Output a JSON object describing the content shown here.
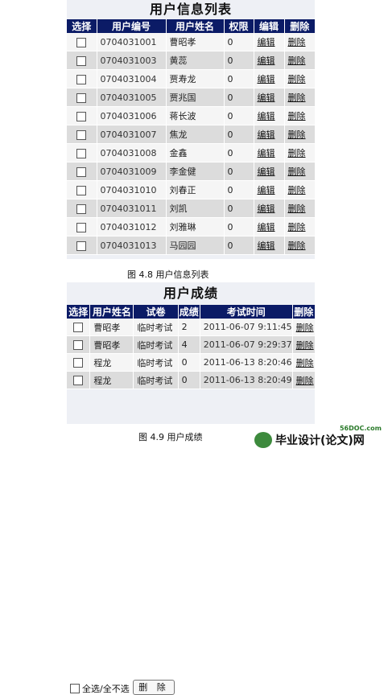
{
  "users_panel": {
    "title": "用户信息列表",
    "headers": [
      "选择",
      "用户编号",
      "用户姓名",
      "权限",
      "编辑",
      "删除"
    ],
    "rows": [
      {
        "id": "0704031001",
        "name": "曹昭孝",
        "perm": "0",
        "edit": "编辑",
        "del": "删除"
      },
      {
        "id": "0704031003",
        "name": "黄蕊",
        "perm": "0",
        "edit": "编辑",
        "del": "删除"
      },
      {
        "id": "0704031004",
        "name": "贾寿龙",
        "perm": "0",
        "edit": "编辑",
        "del": "删除"
      },
      {
        "id": "0704031005",
        "name": "贾兆国",
        "perm": "0",
        "edit": "编辑",
        "del": "删除"
      },
      {
        "id": "0704031006",
        "name": "蒋长波",
        "perm": "0",
        "edit": "编辑",
        "del": "删除"
      },
      {
        "id": "0704031007",
        "name": "焦龙",
        "perm": "0",
        "edit": "编辑",
        "del": "删除"
      },
      {
        "id": "0704031008",
        "name": "金鑫",
        "perm": "0",
        "edit": "编辑",
        "del": "删除"
      },
      {
        "id": "0704031009",
        "name": "李金健",
        "perm": "0",
        "edit": "编辑",
        "del": "删除"
      },
      {
        "id": "0704031010",
        "name": "刘春正",
        "perm": "0",
        "edit": "编辑",
        "del": "删除"
      },
      {
        "id": "0704031011",
        "name": "刘凯",
        "perm": "0",
        "edit": "编辑",
        "del": "删除"
      },
      {
        "id": "0704031012",
        "name": "刘雅琳",
        "perm": "0",
        "edit": "编辑",
        "del": "删除"
      },
      {
        "id": "0704031013",
        "name": "马园园",
        "perm": "0",
        "edit": "编辑",
        "del": "删除"
      }
    ]
  },
  "caption1": "图 4.8  用户信息列表",
  "scores_panel": {
    "title": "用户成绩",
    "headers": [
      "选择",
      "用户姓名",
      "试卷",
      "成绩",
      "考试时间",
      "删除"
    ],
    "rows": [
      {
        "name": "曹昭孝",
        "paper": "临时考试",
        "score": "2",
        "time": "2011-06-07 9:11:45",
        "del": "删除"
      },
      {
        "name": "曹昭孝",
        "paper": "临时考试",
        "score": "4",
        "time": "2011-06-07 9:29:37",
        "del": "删除"
      },
      {
        "name": "程龙",
        "paper": "临时考试",
        "score": "0",
        "time": "2011-06-13 8:20:46",
        "del": "删除"
      },
      {
        "name": "程龙",
        "paper": "临时考试",
        "score": "0",
        "time": "2011-06-13 8:20:49",
        "del": "删除"
      }
    ],
    "select_all_label": "全选/全不选",
    "delete_button_label": "删 除"
  },
  "caption2": "图 4.9  用户成绩",
  "brand": {
    "url": "56DOC.com",
    "name": "毕业设计(论文)网"
  }
}
